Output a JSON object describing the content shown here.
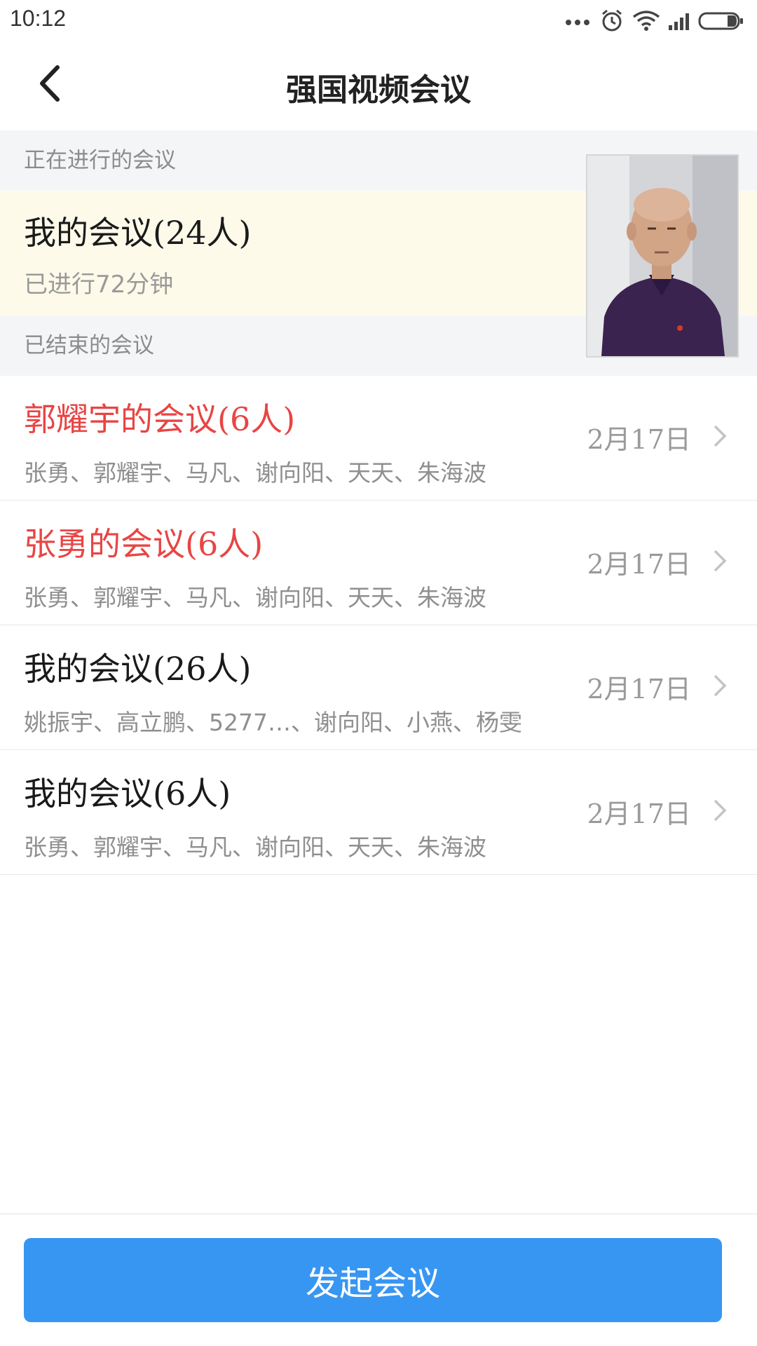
{
  "status_bar": {
    "time": "10:12",
    "icons": [
      "more-dots-icon",
      "alarm-icon",
      "wifi-icon",
      "signal-icon",
      "battery-icon"
    ]
  },
  "header": {
    "title": "强国视频会议",
    "back_icon": "back-chevron-icon"
  },
  "ongoing_section": {
    "label": "正在进行的会议",
    "meeting": {
      "title": "我的会议(24人)",
      "duration": "已进行72分钟"
    }
  },
  "ended_section": {
    "label": "已结束的会议",
    "meetings": [
      {
        "title": "郭耀宇的会议(6人)",
        "members": "张勇、郭耀宇、马凡、谢向阳、天天、朱海波",
        "date": "2月17日",
        "title_color": "#e84545"
      },
      {
        "title": "张勇的会议(6人)",
        "members": "张勇、郭耀宇、马凡、谢向阳、天天、朱海波",
        "date": "2月17日",
        "title_color": "#e84545"
      },
      {
        "title": "我的会议(26人)",
        "members": "姚振宇、高立鹏、5277…、谢向阳、小燕、杨雯",
        "date": "2月17日",
        "title_color": "#1a1a1a"
      },
      {
        "title": "我的会议(6人)",
        "members": "张勇、郭耀宇、马凡、谢向阳、天天、朱海波",
        "date": "2月17日",
        "title_color": "#1a1a1a"
      }
    ]
  },
  "footer": {
    "start_button_label": "发起会议"
  },
  "colors": {
    "accent": "#3896f3",
    "highlight_red": "#e84545",
    "ongoing_bg": "#fdfaea",
    "section_bg": "#f4f5f7"
  }
}
